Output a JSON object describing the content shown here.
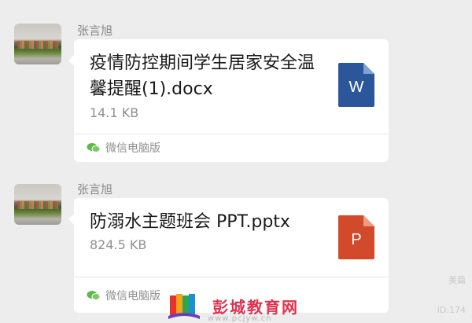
{
  "messages": [
    {
      "sender": "张言旭",
      "file_name": "疫情防控期间学生居家安全温馨提醒(1).docx",
      "file_size": "14.1 KB",
      "source_label": "微信电脑版",
      "file_icon": {
        "letter": "W",
        "color": "#2b579a",
        "name": "word-document-icon"
      }
    },
    {
      "sender": "张言旭",
      "file_name": "防溺水主题班会 PPT.pptx",
      "file_size": "824.5 KB",
      "source_label": "微信电脑版",
      "file_icon": {
        "letter": "P",
        "color": "#d04a2b",
        "name": "powerpoint-document-icon"
      }
    }
  ],
  "watermark": {
    "text": "彭城教育网",
    "url": "www.pcjyw.cn"
  },
  "corner_watermark": {
    "brand": "美篇",
    "id": "ID:174"
  }
}
